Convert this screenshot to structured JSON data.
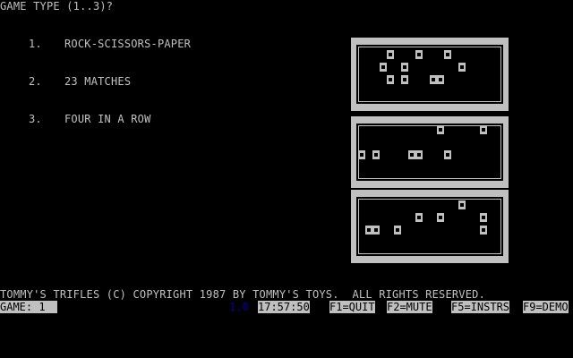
{
  "prompt": "GAME TYPE (1..3)?",
  "menu": [
    {
      "number": "1.",
      "label": "ROCK-SCISSORS-PAPER"
    },
    {
      "number": "2.",
      "label": "23 MATCHES"
    },
    {
      "number": "3.",
      "label": "FOUR IN A ROW"
    }
  ],
  "copyright": "TOMMY'S TRIFLES (C) COPYRIGHT 1987 BY TOMMY'S TOYS.  ALL RIGHTS RESERVED.",
  "status": {
    "game": "GAME: 1  ",
    "version": "1.0",
    "clock": "17:57:50",
    "f1": "F1=QUIT",
    "f2": "F2=MUTE",
    "f5": "F5=INSTRS",
    "f9": "F9=DEMO"
  },
  "colors": {
    "background": "#000000",
    "text": "#c0c0c0",
    "version": "#0000a8"
  }
}
